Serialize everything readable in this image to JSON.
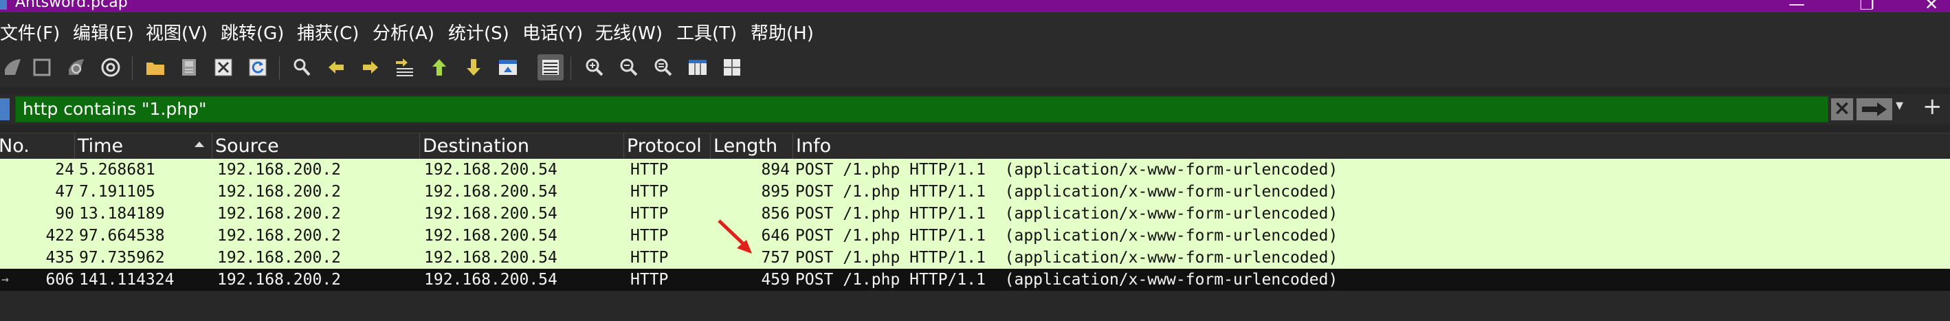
{
  "window": {
    "title": "Antsword.pcap",
    "minimize": "—",
    "maximize": "❐",
    "close": "✕",
    "title_bar_color": "#7b0d8e"
  },
  "menu": [
    "文件(F)",
    "编辑(E)",
    "视图(V)",
    "跳转(G)",
    "捕获(C)",
    "分析(A)",
    "统计(S)",
    "电话(Y)",
    "无线(W)",
    "工具(T)",
    "帮助(H)"
  ],
  "toolbar": {
    "icons": [
      "shark-fin-start-icon",
      "stop-capture-icon",
      "restart-capture-icon",
      "capture-options-icon",
      "open-file-icon",
      "save-file-icon",
      "close-file-icon",
      "reload-file-icon",
      "find-packet-icon",
      "go-back-icon",
      "go-forward-icon",
      "go-to-packet-icon",
      "go-first-packet-icon",
      "go-last-packet-icon",
      "auto-scroll-icon",
      "colorize-icon",
      "zoom-in-icon",
      "zoom-out-icon",
      "zoom-normal-icon",
      "resize-columns-icon",
      "layout-icon"
    ]
  },
  "filter": {
    "value": "http contains \"1.php\"",
    "background": "#0c6b0c"
  },
  "columns": [
    "No.",
    "Time",
    "Source",
    "Destination",
    "Protocol",
    "Length",
    "Info"
  ],
  "packets": [
    {
      "no": "24",
      "time": "5.268681",
      "source": "192.168.200.2",
      "destination": "192.168.200.54",
      "protocol": "HTTP",
      "length": "894",
      "info": "POST /1.php HTTP/1.1  (application/x-www-form-urlencoded)"
    },
    {
      "no": "47",
      "time": "7.191105",
      "source": "192.168.200.2",
      "destination": "192.168.200.54",
      "protocol": "HTTP",
      "length": "895",
      "info": "POST /1.php HTTP/1.1  (application/x-www-form-urlencoded)"
    },
    {
      "no": "90",
      "time": "13.184189",
      "source": "192.168.200.2",
      "destination": "192.168.200.54",
      "protocol": "HTTP",
      "length": "856",
      "info": "POST /1.php HTTP/1.1  (application/x-www-form-urlencoded)"
    },
    {
      "no": "422",
      "time": "97.664538",
      "source": "192.168.200.2",
      "destination": "192.168.200.54",
      "protocol": "HTTP",
      "length": "646",
      "info": "POST /1.php HTTP/1.1  (application/x-www-form-urlencoded)"
    },
    {
      "no": "435",
      "time": "97.735962",
      "source": "192.168.200.2",
      "destination": "192.168.200.54",
      "protocol": "HTTP",
      "length": "757",
      "info": "POST /1.php HTTP/1.1  (application/x-www-form-urlencoded)"
    },
    {
      "no": "606",
      "time": "141.114324",
      "source": "192.168.200.2",
      "destination": "192.168.200.54",
      "protocol": "HTTP",
      "length": "459",
      "info": "POST /1.php HTTP/1.1  (application/x-www-form-urlencoded)",
      "selected": true
    }
  ],
  "colors": {
    "row_http": "#e4ffc7",
    "row_selected": "#111111",
    "annotation_arrow": "#e0201b"
  }
}
